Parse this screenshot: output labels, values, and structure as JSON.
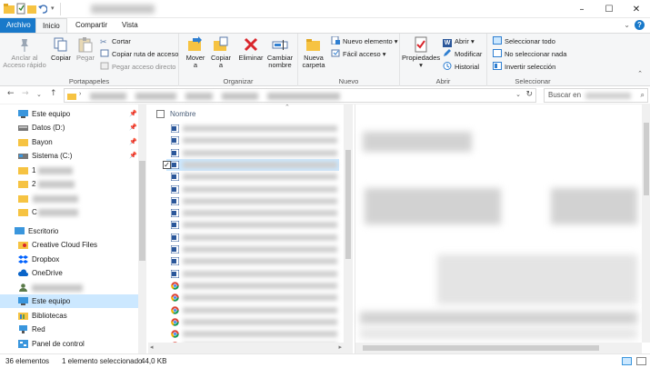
{
  "titlebar": {
    "minimize": "–",
    "maximize": "☐",
    "close": "✕"
  },
  "tabs": {
    "file": "Archivo",
    "home": "Inicio",
    "share": "Compartir",
    "view": "Vista"
  },
  "ribbon": {
    "clipboard": {
      "label": "Portapapeles",
      "pin": "Anclar al Acceso rápido",
      "copy": "Copiar",
      "paste": "Pegar",
      "cut": "Cortar",
      "copy_path": "Copiar ruta de acceso",
      "paste_shortcut": "Pegar acceso directo"
    },
    "organize": {
      "label": "Organizar",
      "move": "Mover a",
      "copy_to": "Copiar a",
      "delete": "Eliminar",
      "rename": "Cambiar nombre"
    },
    "new": {
      "label": "Nuevo",
      "new_folder": "Nueva carpeta",
      "new_item": "Nuevo elemento",
      "easy_access": "Fácil acceso"
    },
    "open": {
      "label": "Abrir",
      "properties": "Propiedades",
      "open": "Abrir",
      "edit": "Modificar",
      "history": "Historial"
    },
    "select": {
      "label": "Seleccionar",
      "select_all": "Seleccionar todo",
      "select_none": "No seleccionar nada",
      "invert": "Invertir selección"
    }
  },
  "address": {
    "search_placeholder": "Buscar en"
  },
  "nav": {
    "items": [
      {
        "label": "Este equipo"
      },
      {
        "label": "Datos (D:)"
      },
      {
        "label": "Bayon"
      },
      {
        "label": "Sistema (C:)"
      },
      {
        "label": "1"
      },
      {
        "label": "2"
      },
      {
        "label": ""
      },
      {
        "label": "C"
      },
      {
        "label": "Escritorio"
      },
      {
        "label": "Creative Cloud Files"
      },
      {
        "label": "Dropbox"
      },
      {
        "label": "OneDrive"
      },
      {
        "label": ""
      },
      {
        "label": "Este equipo"
      },
      {
        "label": "Bibliotecas"
      },
      {
        "label": "Red"
      },
      {
        "label": "Panel de control"
      }
    ]
  },
  "filelist": {
    "column_name": "Nombre",
    "sort_arrow": "⌃"
  },
  "status": {
    "count": "36 elementos",
    "selection": "1 elemento seleccionado",
    "size": "44,0 KB"
  },
  "colors": {
    "accent": "#1979ca",
    "selection": "#cce8ff",
    "folder": "#f6c342",
    "delete_red": "#d9262c"
  }
}
